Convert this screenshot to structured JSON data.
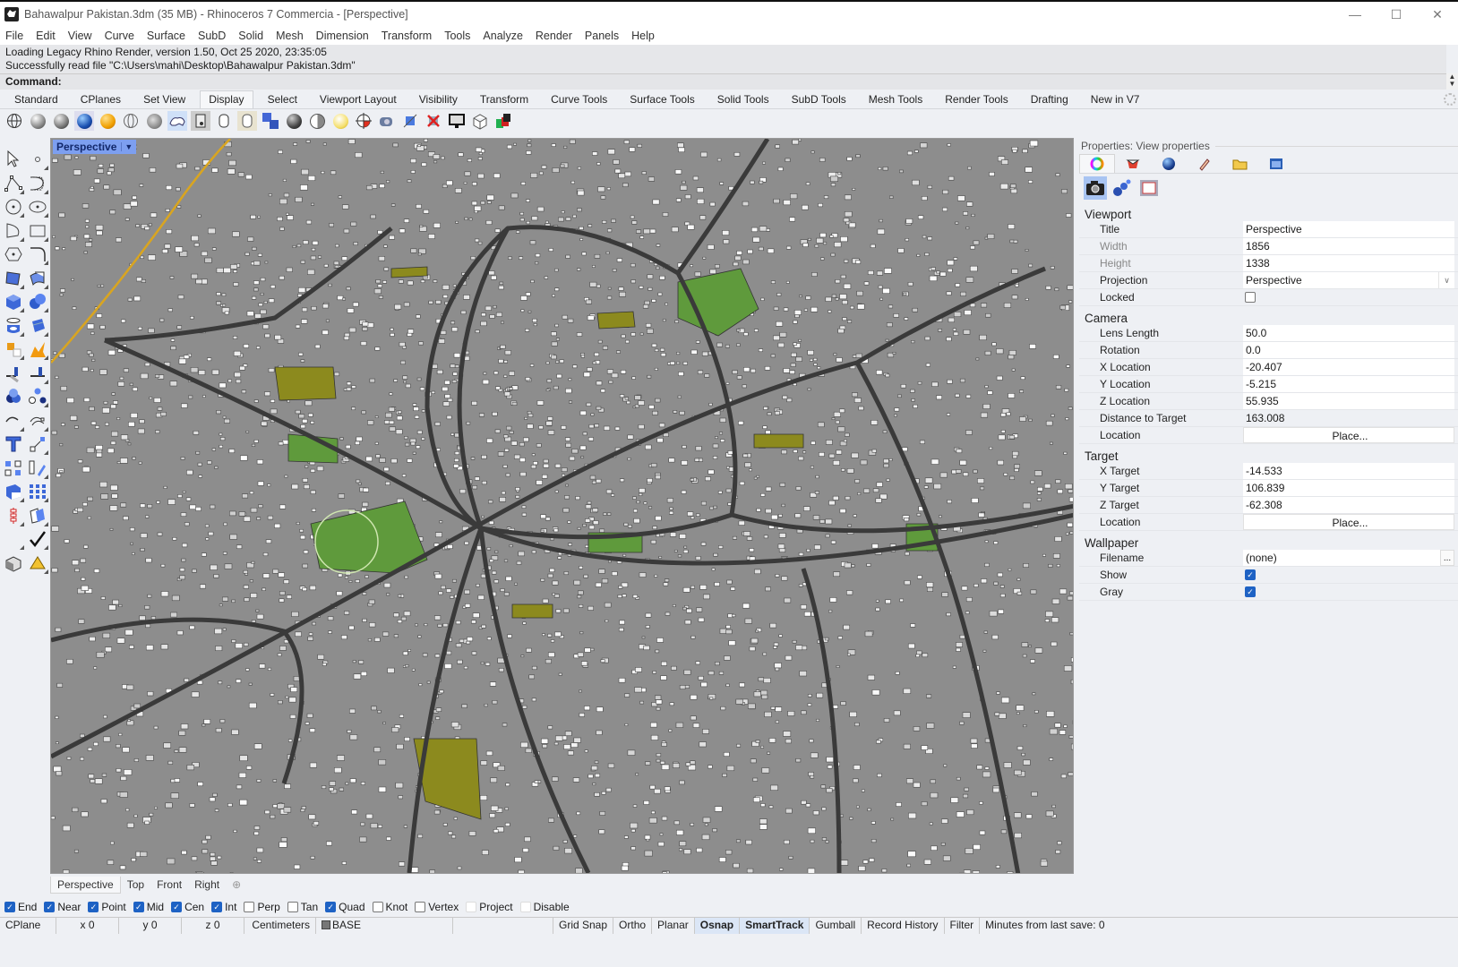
{
  "window": {
    "title": "Bahawalpur Pakistan.3dm (35 MB) - Rhinoceros 7 Commercia - [Perspective]",
    "controls": [
      "minimize",
      "maximize",
      "close"
    ]
  },
  "menu": [
    "File",
    "Edit",
    "View",
    "Curve",
    "Surface",
    "SubD",
    "Solid",
    "Mesh",
    "Dimension",
    "Transform",
    "Tools",
    "Analyze",
    "Render",
    "Panels",
    "Help"
  ],
  "command_history": [
    "Loading Legacy Rhino Render, version 1.50, Oct 25 2020, 23:35:05",
    "Successfully read file \"C:\\Users\\mahi\\Desktop\\Bahawalpur Pakistan.3dm\""
  ],
  "command_prompt": "Command:",
  "toolbar_tabs": {
    "active": "Display",
    "items": [
      "Standard",
      "CPlanes",
      "Set View",
      "Display",
      "Select",
      "Viewport Layout",
      "Visibility",
      "Transform",
      "Curve Tools",
      "Surface Tools",
      "Solid Tools",
      "SubD Tools",
      "Mesh Tools",
      "Render Tools",
      "Drafting",
      "New in V7"
    ]
  },
  "display_icons": [
    "wireframe",
    "shaded",
    "rendered",
    "ghosted",
    "xray",
    "technical",
    "artistic",
    "pen",
    "arctic",
    "raytraced",
    "monochrome",
    "flat-shade",
    "display-options",
    "render-mesh",
    "lighting",
    "material",
    "cplane",
    "camera",
    "capture",
    "close-display",
    "monitor",
    "wire-box",
    "color-box"
  ],
  "side_tools": [
    "select",
    "point",
    "polyline",
    "curve",
    "circle",
    "ellipse",
    "arc",
    "rectangle",
    "polygon",
    "fillet-curve",
    "surface-from-points",
    "extrude-surface",
    "box",
    "sphere",
    "cylinder",
    "plane",
    "explode",
    "split",
    "trim",
    "extend",
    "boolean-union",
    "boolean-split",
    "fillet",
    "offset-curve",
    "text",
    "move",
    "group",
    "mirror",
    "solid-tools",
    "grid-array",
    "array",
    "align",
    "layer",
    "check",
    "render-preview",
    "lights"
  ],
  "viewport": {
    "label": "Perspective",
    "tabs": [
      "Perspective",
      "Top",
      "Front",
      "Right"
    ],
    "active_tab": "Perspective",
    "scene": "3D city model of Bahawalpur, Pakistan - gray buildings with green and olive parks and dark road network"
  },
  "properties": {
    "title": "Properties: View properties",
    "tabs": [
      "color-wheel",
      "layer-stack",
      "sphere-material",
      "texture-pencil",
      "folder",
      "named-view"
    ],
    "subtabs": [
      "camera",
      "lights",
      "frame"
    ],
    "sections": [
      {
        "name": "Viewport",
        "rows": [
          {
            "label": "Title",
            "value": "Perspective",
            "type": "text"
          },
          {
            "label": "Width",
            "value": "1856",
            "type": "text",
            "dim": true
          },
          {
            "label": "Height",
            "value": "1338",
            "type": "text",
            "dim": true
          },
          {
            "label": "Projection",
            "value": "Perspective",
            "type": "dropdown"
          },
          {
            "label": "Locked",
            "value": false,
            "type": "checkbox"
          }
        ]
      },
      {
        "name": "Camera",
        "rows": [
          {
            "label": "Lens Length",
            "value": "50.0",
            "type": "text"
          },
          {
            "label": "Rotation",
            "value": "0.0",
            "type": "text"
          },
          {
            "label": "X Location",
            "value": "-20.407",
            "type": "text"
          },
          {
            "label": "Y Location",
            "value": "-5.215",
            "type": "text"
          },
          {
            "label": "Z Location",
            "value": "55.935",
            "type": "text"
          },
          {
            "label": "Distance to Target",
            "value": "163.008",
            "type": "plain"
          },
          {
            "label": "Location",
            "value": "Place...",
            "type": "button"
          }
        ]
      },
      {
        "name": "Target",
        "rows": [
          {
            "label": "X Target",
            "value": "-14.533",
            "type": "text"
          },
          {
            "label": "Y Target",
            "value": "106.839",
            "type": "text"
          },
          {
            "label": "Z Target",
            "value": "-62.308",
            "type": "text"
          },
          {
            "label": "Location",
            "value": "Place...",
            "type": "button"
          }
        ]
      },
      {
        "name": "Wallpaper",
        "rows": [
          {
            "label": "Filename",
            "value": "(none)",
            "type": "file"
          },
          {
            "label": "Show",
            "value": true,
            "type": "checkbox"
          },
          {
            "label": "Gray",
            "value": true,
            "type": "checkbox"
          }
        ]
      }
    ]
  },
  "osnaps": [
    {
      "label": "End",
      "checked": true
    },
    {
      "label": "Near",
      "checked": true
    },
    {
      "label": "Point",
      "checked": true
    },
    {
      "label": "Mid",
      "checked": true
    },
    {
      "label": "Cen",
      "checked": true
    },
    {
      "label": "Int",
      "checked": true
    },
    {
      "label": "Perp",
      "checked": false
    },
    {
      "label": "Tan",
      "checked": false
    },
    {
      "label": "Quad",
      "checked": true
    },
    {
      "label": "Knot",
      "checked": false
    },
    {
      "label": "Vertex",
      "checked": false
    },
    {
      "label": "Project",
      "checked": false
    },
    {
      "label": "Disable",
      "checked": false
    }
  ],
  "status": {
    "cplane": "CPlane",
    "x": "x 0",
    "y": "y 0",
    "z": "z 0",
    "units": "Centimeters",
    "layer": "BASE",
    "toggles": [
      {
        "label": "Grid Snap",
        "on": false
      },
      {
        "label": "Ortho",
        "on": false
      },
      {
        "label": "Planar",
        "on": false
      },
      {
        "label": "Osnap",
        "on": true
      },
      {
        "label": "SmartTrack",
        "on": true
      },
      {
        "label": "Gumball",
        "on": false
      },
      {
        "label": "Record History",
        "on": false
      },
      {
        "label": "Filter",
        "on": false
      }
    ],
    "save_info": "Minutes from last save: 0"
  },
  "colors": {
    "accent": "#1e62c4",
    "viewport_label_bg": "#7d9ff0",
    "park_green": "#5f9a3c",
    "park_olive": "#8c8a1e",
    "ground": "#8d8d8d",
    "road": "#3a3a3a"
  }
}
